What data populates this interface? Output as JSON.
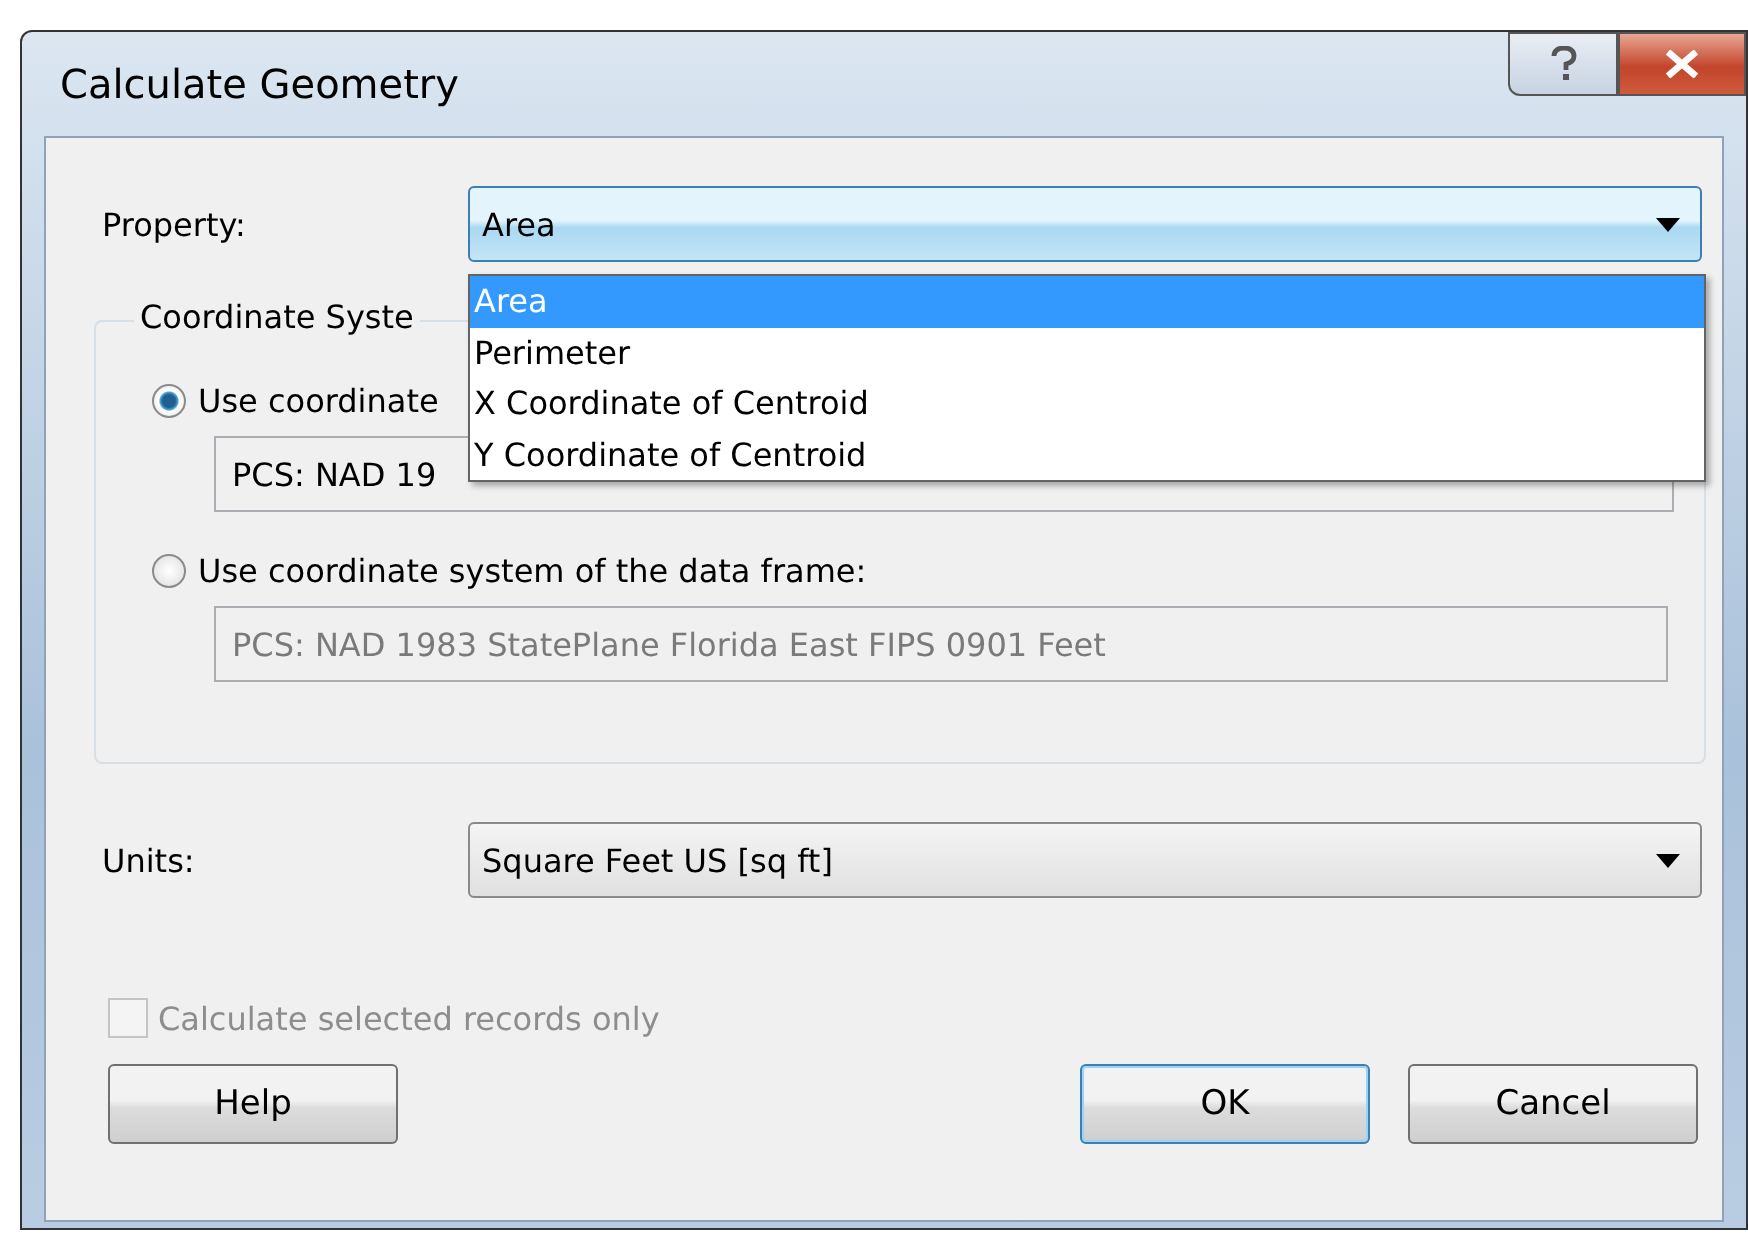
{
  "window": {
    "title": "Calculate Geometry"
  },
  "property": {
    "label": "Property:",
    "value": "Area",
    "open": true,
    "options": [
      {
        "label": "Area",
        "selected": true
      },
      {
        "label": "Perimeter",
        "selected": false
      },
      {
        "label": "X Coordinate of Centroid",
        "selected": false
      },
      {
        "label": "Y Coordinate of Centroid",
        "selected": false
      }
    ]
  },
  "coordinate_group": {
    "label": "Coordinate Syste",
    "options": [
      {
        "label": "Use coordinate",
        "selected": true,
        "value": "PCS: NAD 19",
        "disabled": false
      },
      {
        "label": "Use coordinate system of the data frame:",
        "selected": false,
        "value": "PCS: NAD 1983 StatePlane Florida East FIPS 0901 Feet",
        "disabled": true
      }
    ]
  },
  "units": {
    "label": "Units:",
    "value": "Square Feet US [sq ft]"
  },
  "selected_only": {
    "label": "Calculate selected records only",
    "checked": false,
    "disabled": true
  },
  "help_button": {
    "label": "Help"
  },
  "buttons": [
    {
      "label": "OK",
      "default": true
    },
    {
      "label": "Cancel",
      "default": false
    }
  ]
}
